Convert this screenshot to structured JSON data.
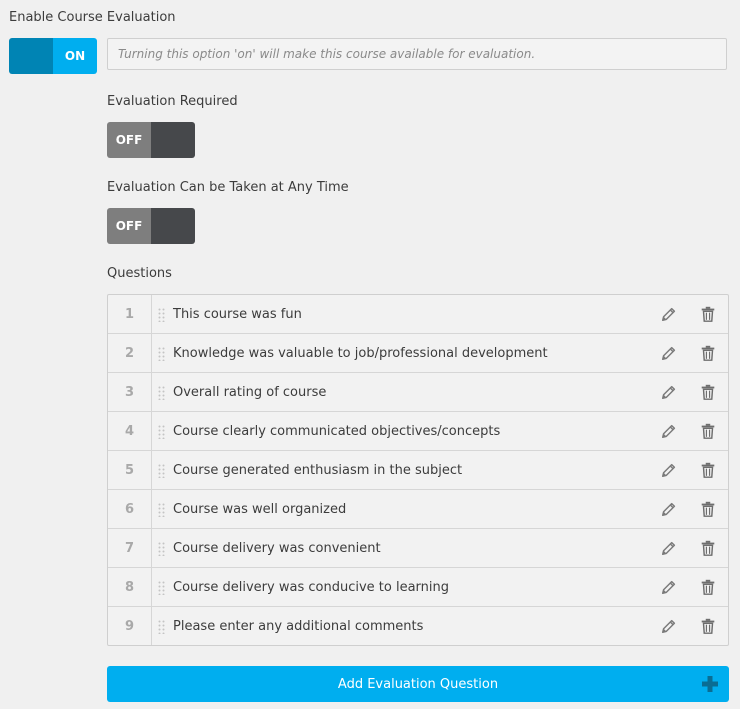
{
  "evaluation": {
    "enable_label": "Enable Course Evaluation",
    "enable_state": "ON",
    "enable_hint": "Turning this option 'on' will make this course available for evaluation.",
    "required_label": "Evaluation Required",
    "required_state": "OFF",
    "anytime_label": "Evaluation Can be Taken at Any Time",
    "anytime_state": "OFF"
  },
  "questions": {
    "label": "Questions",
    "items": [
      {
        "num": "1",
        "text": "This course was fun"
      },
      {
        "num": "2",
        "text": "Knowledge was valuable to job/professional development"
      },
      {
        "num": "3",
        "text": "Overall rating of course"
      },
      {
        "num": "4",
        "text": "Course clearly communicated objectives/concepts"
      },
      {
        "num": "5",
        "text": "Course generated enthusiasm in the subject"
      },
      {
        "num": "6",
        "text": "Course was well organized"
      },
      {
        "num": "7",
        "text": "Course delivery was convenient"
      },
      {
        "num": "8",
        "text": "Course delivery was conducive to learning"
      },
      {
        "num": "9",
        "text": "Please enter any additional comments"
      }
    ],
    "add_button": "Add Evaluation Question"
  },
  "colors": {
    "accent": "#00aeef",
    "accent_dark": "#0084b4",
    "toggle_off": "#7e7e7e",
    "toggle_off_knob": "#46484b"
  },
  "icons": {
    "row_grip": "drag-handle-icon",
    "row_edit": "pencil-icon",
    "row_delete": "trash-icon",
    "add": "plus-icon"
  }
}
